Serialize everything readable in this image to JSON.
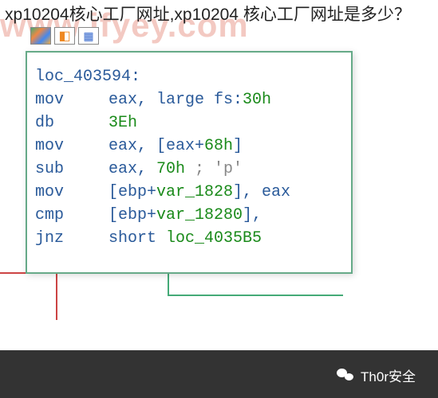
{
  "watermark_text": "www.ifyey.com",
  "heading_text": "xp10204核心工厂网址,xp10204 核心工厂网址是多少？",
  "icons": {
    "paint": "paint-icon",
    "pixel": "pixel-icon",
    "file": "file-icon"
  },
  "code": {
    "label": "loc_403594:",
    "lines": [
      {
        "mnem": "mov",
        "ops_pre": "eax, large fs:",
        "lit": "30h"
      },
      {
        "mnem": "db",
        "ops_pre": "",
        "lit": "3Eh"
      },
      {
        "mnem": "mov",
        "ops_pre": "eax, [eax+",
        "lit": "68h",
        "ops_post": "]"
      },
      {
        "mnem": "sub",
        "ops_pre": "eax, ",
        "lit": "70h",
        "comment": " ; 'p'"
      },
      {
        "mnem": "mov",
        "ops_pre": "[ebp+",
        "var": "var_1828",
        "ops_post": "], eax"
      },
      {
        "mnem": "cmp",
        "ops_pre": "[ebp+",
        "var": "var_1828",
        "ops_post": "], ",
        "lit": "0"
      },
      {
        "mnem": "jnz",
        "ops_pre": "short ",
        "target": "loc_4035B5"
      }
    ]
  },
  "footer": {
    "brand": "Th0r安全"
  }
}
